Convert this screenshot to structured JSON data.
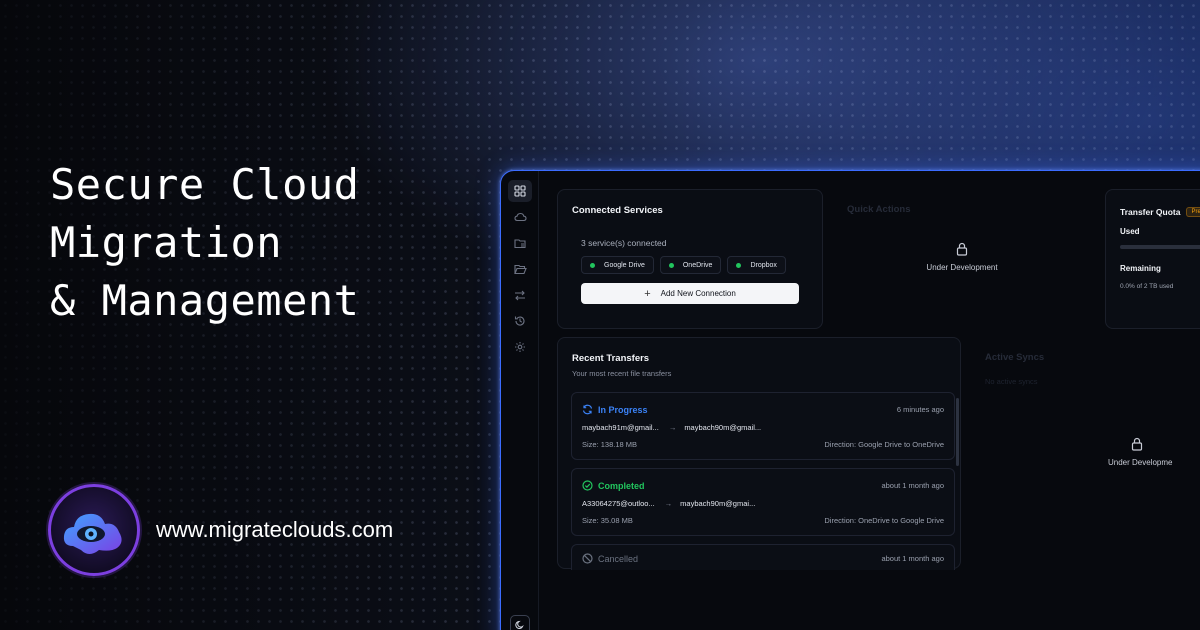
{
  "hero": {
    "line1": "Secure Cloud",
    "line2": "Migration",
    "line3": "& Management"
  },
  "brand": {
    "url": "www.migrateclouds.com",
    "logo_icon": "cloud-eye-logo-icon"
  },
  "sidebar": {
    "items": [
      {
        "icon": "dashboard-grid-icon",
        "active": true
      },
      {
        "icon": "cloud-icon"
      },
      {
        "icon": "folder-list-icon"
      },
      {
        "icon": "folder-open-icon"
      },
      {
        "icon": "transfer-arrows-icon"
      },
      {
        "icon": "history-icon"
      },
      {
        "icon": "settings-gear-icon"
      }
    ],
    "bottom_icon": "moon-theme-icon"
  },
  "connected_services": {
    "title": "Connected Services",
    "summary": "3 service(s) connected",
    "services": [
      "Google Drive",
      "OneDrive",
      "Dropbox"
    ],
    "add_button": "Add New Connection"
  },
  "quick_actions": {
    "title": "Quick Actions",
    "lock_label": "Under Development"
  },
  "transfer_quota": {
    "title": "Transfer Quota",
    "badge": "Pre",
    "used_label": "Used",
    "remaining_label": "Remaining",
    "remaining_text": "0.0% of 2 TB used",
    "used_fraction": 0.0
  },
  "recent_transfers": {
    "title": "Recent Transfers",
    "subtitle": "Your most recent file transfers",
    "items": [
      {
        "status": "In Progress",
        "time": "6 minutes ago",
        "from": "maybach91m@gmail...",
        "to": "maybach90m@gmail...",
        "size": "Size: 138.18 MB",
        "direction": "Direction: Google Drive to OneDrive"
      },
      {
        "status": "Completed",
        "time": "about 1 month ago",
        "from": "A33064275@outloo...",
        "to": "maybach90m@gmai...",
        "size": "Size: 35.08 MB",
        "direction": "Direction: OneDrive to Google Drive"
      },
      {
        "status": "Cancelled",
        "time": "about 1 month ago"
      }
    ]
  },
  "active_syncs": {
    "title": "Active Syncs",
    "subtitle": "No active syncs",
    "lock_label": "Under Developme"
  },
  "colors": {
    "accent_border": "#3b6cff",
    "in_progress": "#3b82f6",
    "completed": "#22c55e",
    "cancelled": "#6b7280",
    "premium_badge": "#f59e0b"
  }
}
